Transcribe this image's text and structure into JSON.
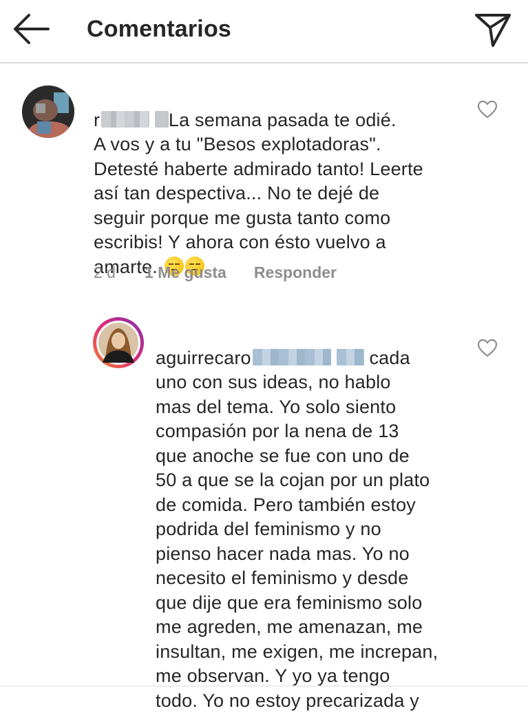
{
  "header": {
    "title": "Comentarios",
    "back_icon": "arrow-left-icon",
    "send_icon": "paper-plane-icon"
  },
  "comments": [
    {
      "username_visible": "r",
      "username_blur_icon": "blurred-username",
      "text": "La semana pasada te odié.\nA vos y a tu \"Besos explotadoras\".\nDetesté haberte admirado tanto! Leerte\nasí tan despectiva... No te dejé de\nseguir porque me gusta tanto como\nescribis! Y ahora con ésto vuelvo a\namarte.",
      "emoji_icon": "unamused-face-emoji",
      "time": "2 d",
      "likes": "1 Me gusta",
      "reply": "Responder"
    },
    {
      "username": "aguirrecaro",
      "mention_blur_icon": "blurred-mention",
      "first_word": "cada",
      "text": "uno con sus ideas, no hablo\nmas del tema. Yo solo siento\ncompasión por la nena de 13\nque anoche se fue con uno de\n50 a que se la cojan por un plato\nde comida. Pero también estoy\npodrida del feminismo y no\npienso hacer nada mas. Yo no\nnecesito el feminismo y desde\nque dije que era feminismo solo\nme agreden, me amenazan, me\ninsultan, me exigen, me increpan,\nme observan. Y yo ya tengo\ntodo. Yo no estoy precarizada y"
    }
  ],
  "colors": {
    "text": "#262626",
    "meta": "#8e8e8e",
    "divider": "#dbdbdb",
    "story_ring": "#e1306c"
  }
}
